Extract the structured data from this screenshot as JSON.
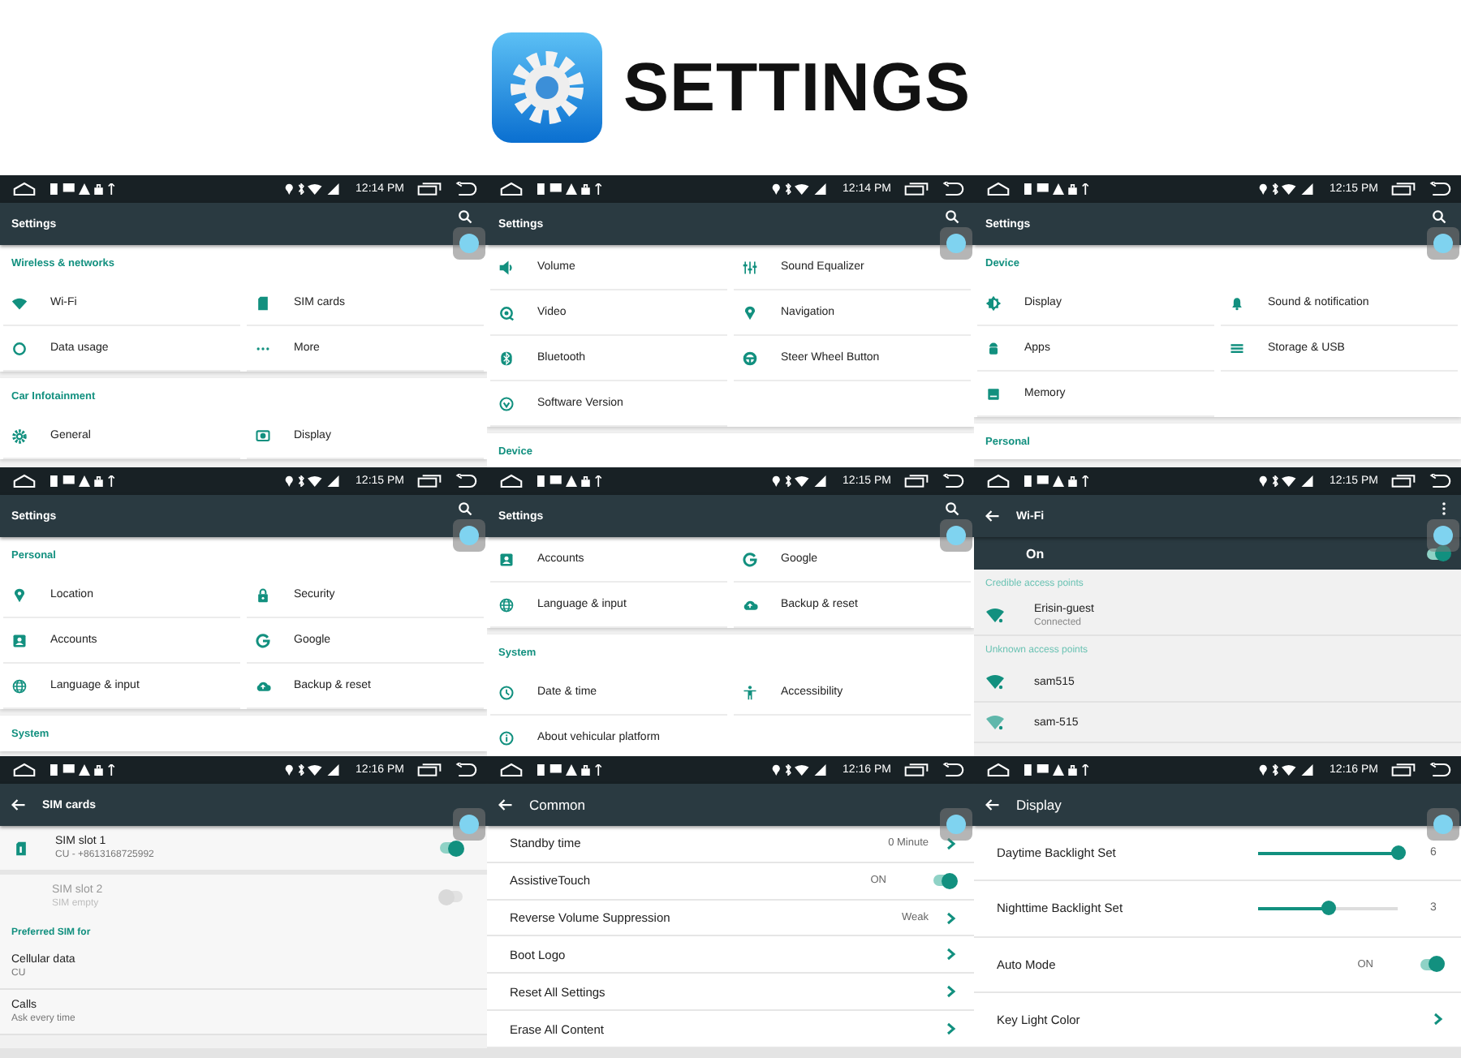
{
  "header": {
    "title": "SETTINGS"
  },
  "panels": [
    {
      "kind": "grid",
      "time": "12:14 PM",
      "title": "Settings",
      "back": false,
      "search_button": true,
      "sections": [
        {
          "header": "Wireless & networks",
          "items": [
            "Wi-Fi",
            "SIM cards",
            "Data usage",
            "More"
          ]
        },
        {
          "header": "Car Infotainment",
          "items": [
            "General",
            "Display"
          ]
        }
      ]
    },
    {
      "kind": "grid",
      "time": "12:14 PM",
      "title": "Settings",
      "back": false,
      "search_button": true,
      "sections": [
        {
          "items": [
            "Volume",
            "Sound Equalizer",
            "Video",
            "Navigation",
            "Bluetooth",
            "Steer Wheel Button",
            "Software Version"
          ]
        },
        {
          "header": "Device"
        }
      ]
    },
    {
      "kind": "grid",
      "time": "12:15 PM",
      "title": "Settings",
      "back": false,
      "search_button": true,
      "sections": [
        {
          "header": "Device",
          "items": [
            "Display",
            "Sound & notification",
            "Apps",
            "Storage & USB",
            "Memory"
          ]
        },
        {
          "header": "Personal"
        }
      ]
    },
    {
      "kind": "grid",
      "time": "12:15 PM",
      "title": "Settings",
      "back": false,
      "search_button": true,
      "sections": [
        {
          "header": "Personal",
          "items": [
            "Location",
            "Security",
            "Accounts",
            "Google",
            "Language & input",
            "Backup & reset"
          ]
        },
        {
          "header": "System"
        }
      ]
    },
    {
      "kind": "grid",
      "time": "12:15 PM",
      "title": "Settings",
      "back": false,
      "search_button": true,
      "sections": [
        {
          "items": [
            "Accounts",
            "Google",
            "Language & input",
            "Backup & reset"
          ]
        },
        {
          "header": "System",
          "items": [
            "Date & time",
            "Accessibility",
            "About vehicular platform"
          ]
        }
      ]
    },
    {
      "kind": "wifi",
      "time": "12:15 PM",
      "title": "Wi-Fi",
      "back": true,
      "overflow_menu": true,
      "master": {
        "label": "On",
        "on": true
      },
      "groups": [
        {
          "header": "Credible access points",
          "networks": [
            {
              "name": "Erisin-guest",
              "status": "Connected"
            }
          ]
        },
        {
          "header": "Unknown access points",
          "networks": [
            {
              "name": "sam515"
            },
            {
              "name": "sam-515"
            }
          ]
        }
      ]
    },
    {
      "kind": "sim",
      "time": "12:16 PM",
      "title": "SIM cards",
      "back": true,
      "slots": [
        {
          "name": "SIM slot 1",
          "detail": "CU - +8613168725992",
          "on": true,
          "disabled": false
        },
        {
          "name": "SIM slot 2",
          "detail": "SIM empty",
          "on": false,
          "disabled": true
        }
      ],
      "preferred": {
        "header": "Preferred SIM for",
        "items": [
          {
            "label": "Cellular data",
            "value": "CU"
          },
          {
            "label": "Calls",
            "value": "Ask every time"
          }
        ]
      }
    },
    {
      "kind": "rows",
      "time": "12:16 PM",
      "title": "Common",
      "back": true,
      "rows": [
        {
          "kind": "link",
          "label": "Standby time",
          "value": "0 Minute"
        },
        {
          "kind": "switch",
          "label": "AssistiveTouch",
          "value": "ON",
          "on": true
        },
        {
          "kind": "link",
          "label": "Reverse Volume Suppression",
          "value": "Weak"
        },
        {
          "kind": "link",
          "label": "Boot Logo"
        },
        {
          "kind": "link",
          "label": "Reset All Settings"
        },
        {
          "kind": "link",
          "label": "Erase All Content"
        }
      ]
    },
    {
      "kind": "rows",
      "time": "12:16 PM",
      "title": "Display",
      "back": true,
      "rows": [
        {
          "kind": "slider",
          "label": "Daytime Backlight Set",
          "level": 1,
          "value": "6"
        },
        {
          "kind": "slider",
          "label": "Nighttime Backlight Set",
          "level": 0.5,
          "value": "3"
        },
        {
          "kind": "switch",
          "label": "Auto Mode",
          "value": "ON",
          "on": true
        },
        {
          "kind": "link",
          "label": "Key Light Color"
        }
      ]
    }
  ]
}
